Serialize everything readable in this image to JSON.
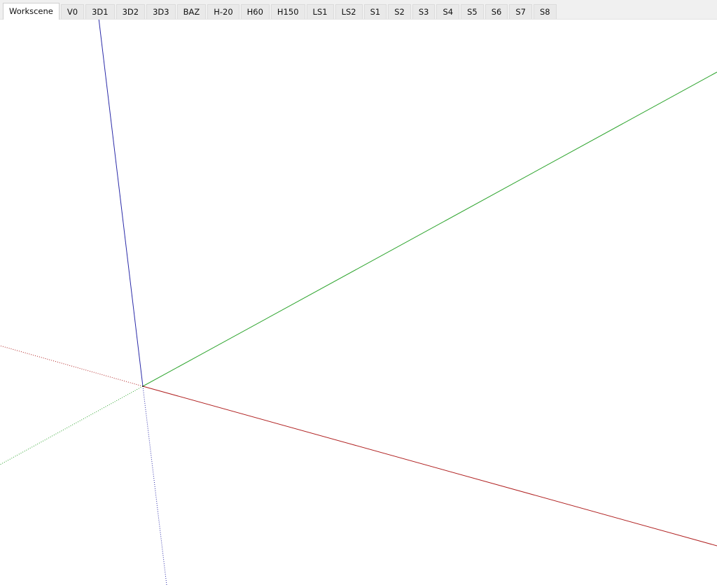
{
  "scene_tabs": {
    "active": "Workscene",
    "items": [
      {
        "label": "Workscene"
      },
      {
        "label": "V0"
      },
      {
        "label": "3D1"
      },
      {
        "label": "3D2"
      },
      {
        "label": "3D3"
      },
      {
        "label": "BAZ"
      },
      {
        "label": "H-20"
      },
      {
        "label": "H60"
      },
      {
        "label": "H150"
      },
      {
        "label": "LS1"
      },
      {
        "label": "LS2"
      },
      {
        "label": "S1"
      },
      {
        "label": "S2"
      },
      {
        "label": "S3"
      },
      {
        "label": "S4"
      },
      {
        "label": "S5"
      },
      {
        "label": "S6"
      },
      {
        "label": "S7"
      },
      {
        "label": "S8"
      }
    ]
  },
  "viewport": {
    "axes": {
      "red": "#b02020",
      "green": "#2fa52f",
      "blue": "#2a2aa8",
      "negative_style": "dotted"
    }
  }
}
